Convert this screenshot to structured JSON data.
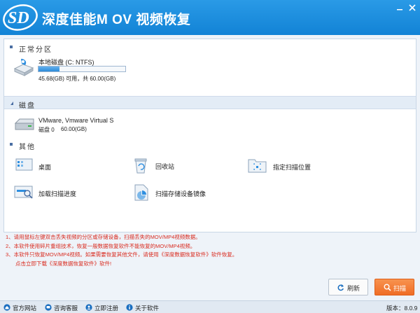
{
  "app": {
    "title": "深度佳能M OV 视频恢复",
    "logo_text": "SD"
  },
  "sections": {
    "partitions": "正常分区",
    "disks": "磁盘",
    "others": "其他"
  },
  "partition": {
    "name": "本地磁盘 (C: NTFS)",
    "usage_text": "45.68(GB) 可用，共 60.00(GB)",
    "used_fraction": 0.24
  },
  "disk": {
    "name": "VMware, Vmware Virtual S",
    "label": "磁盘 0",
    "size": "60.00(GB)"
  },
  "tools": {
    "desktop": "桌面",
    "recycle": "回收站",
    "scan_location": "指定扫描位置",
    "load_progress": "加载扫描进度",
    "scan_image": "扫描存储设备镜像"
  },
  "notes": [
    "1、请用鼠标左键双击丢失视频的分区或存储设备，扫描丢失的MOV/MP4视频数据。",
    "2、本软件使用碎片重组技术，恢复一般数据恢复软件不能恢复的MOV/MP4视频。",
    "3、本软件只恢复MOV/MP4视频。如果需要恢复其他文件，请使用《深度数据恢复软件》软件恢复。",
    "点击立即下载《深度数据恢复软件》软件!"
  ],
  "buttons": {
    "refresh": "刷新",
    "scan": "扫描"
  },
  "statusbar": {
    "website": "官方网站",
    "support": "咨询客服",
    "register": "立即注册",
    "about": "关于软件",
    "version": "版本：8.0.9"
  },
  "colors": {
    "title_bar": "#1a8de0",
    "accent_orange": "#f07a30",
    "note_red": "#d92b1f"
  }
}
